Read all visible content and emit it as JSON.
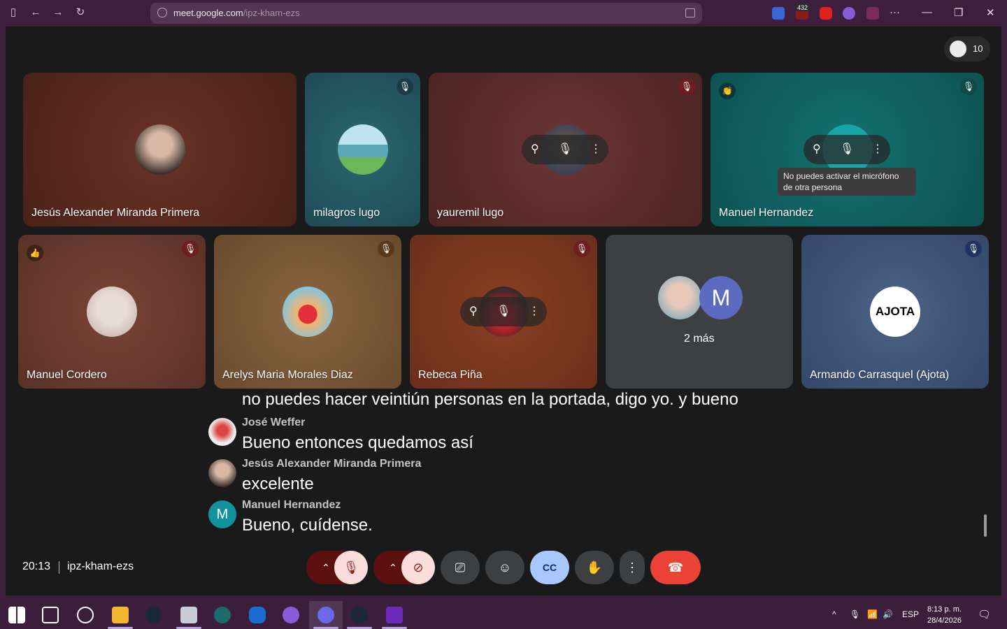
{
  "browser": {
    "url_domain": "meet.google.com",
    "url_path": "/ipz-kham-ezs",
    "extension_badge": "432",
    "menu_glyph": "···",
    "window_controls": [
      "—",
      "❐",
      "✕"
    ]
  },
  "meet": {
    "participant_count": "10",
    "tiles": [
      {
        "name": "Jesús Alexander Miranda Primera",
        "mic": "on",
        "bg": "#5a2a20"
      },
      {
        "name": "milagros lugo",
        "mic": "muted",
        "bg": "#1f4f55"
      },
      {
        "name": "yauremil lugo",
        "mic": "muted",
        "bg": "#5a2b2a"
      },
      {
        "name": "Manuel Hernandez",
        "mic": "muted",
        "bg": "#0e5a5a",
        "reaction": "👏"
      },
      {
        "name": "Manuel Cordero",
        "mic": "muted",
        "bg": "#6a3b32",
        "reaction": "👍"
      },
      {
        "name": "Arelys Maria Morales Diaz",
        "mic": "muted",
        "bg": "#7a5a35"
      },
      {
        "name": "Rebeca Piña",
        "mic": "muted",
        "bg": "#7a3a20"
      },
      {
        "name": "Armando Carrasquel (Ajota)",
        "mic": "muted",
        "bg": "#3b4f6e"
      }
    ],
    "more_tile": {
      "label": "2 más",
      "avatar_letter": "M"
    },
    "ajota_logo": "AJOTA",
    "tooltip": "No puedes activar el micrófono de otra persona",
    "captions": [
      {
        "speaker": "",
        "text": "no puedes hacer veintiún personas en la portada, digo yo. y bueno"
      },
      {
        "speaker": "José Weffer",
        "text": "Bueno entonces quedamos así"
      },
      {
        "speaker": "Jesús Alexander Miranda Primera",
        "text": "excelente"
      },
      {
        "speaker": "Manuel Hernandez",
        "text": "Bueno, cuídense.",
        "avatar_letter": "M"
      }
    ],
    "time": "20:13",
    "meeting_code": "ipz-kham-ezs",
    "accent_red": "#ea4335",
    "accent_blue": "#a8c7fa"
  },
  "taskbar": {
    "language": "ESP",
    "time": "8:13 p. m.",
    "date": "28/4/2026"
  }
}
